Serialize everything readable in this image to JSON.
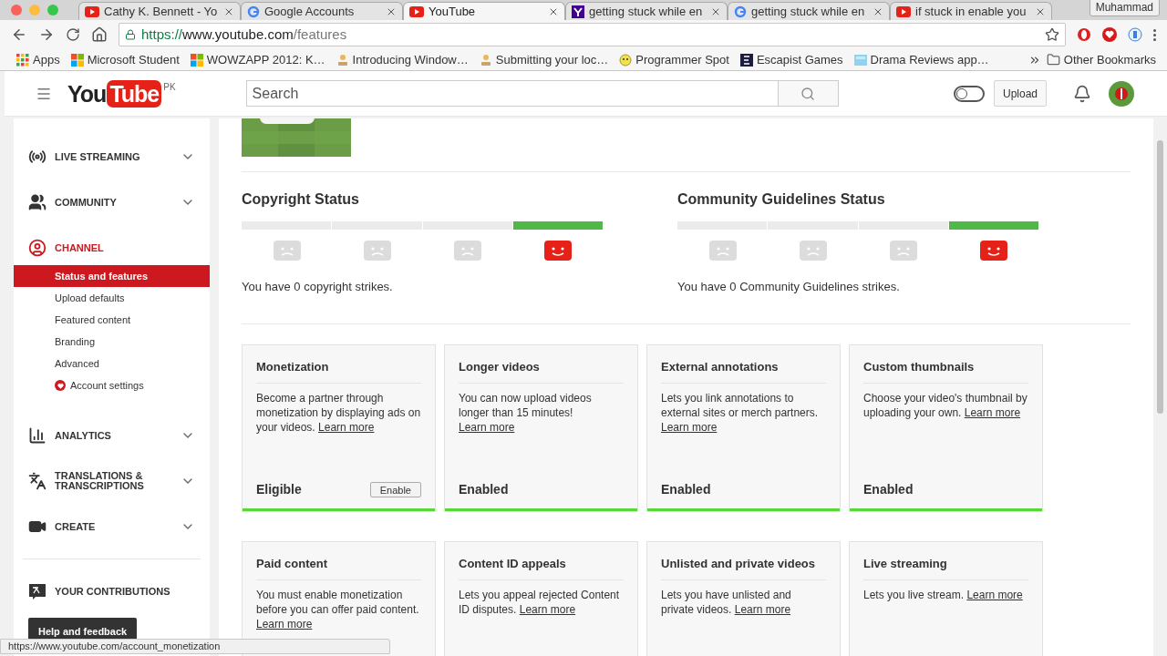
{
  "browser": {
    "tabs": [
      {
        "title": "Cathy K. Bennett - Yo",
        "kind": "youtube",
        "selected": false
      },
      {
        "title": "Google Accounts",
        "kind": "google",
        "selected": false
      },
      {
        "title": "YouTube",
        "kind": "youtube",
        "selected": true
      },
      {
        "title": "getting stuck while en",
        "kind": "yahoo",
        "selected": false
      },
      {
        "title": "getting stuck while en",
        "kind": "google",
        "selected": false
      },
      {
        "title": "if stuck in enable you",
        "kind": "youtube",
        "selected": false
      }
    ],
    "profile": "Muhammad",
    "url_scheme": "https://",
    "url_host": "www.youtube.com",
    "url_path": "/features",
    "bookmarks": [
      {
        "label": "Apps",
        "kind": "apps"
      },
      {
        "label": "Microsoft Student",
        "kind": "windows"
      },
      {
        "label": "WOWZAPP 2012: K…",
        "kind": "windows"
      },
      {
        "label": "Introducing Window…",
        "kind": "figure"
      },
      {
        "label": "Submitting your loc…",
        "kind": "figure"
      },
      {
        "label": "Programmer Spot",
        "kind": "smiley"
      },
      {
        "label": "Escapist Games",
        "kind": "dark"
      },
      {
        "label": "Drama Reviews app…",
        "kind": "tile"
      }
    ],
    "other_bookmarks": "Other Bookmarks",
    "status_url": "https://www.youtube.com/account_monetization"
  },
  "header": {
    "logo_you": "You",
    "logo_tube": "Tube",
    "region": "PK",
    "search": {
      "placeholder": "Search"
    },
    "toggle": {
      "on": false
    },
    "upload": "Upload"
  },
  "sidebar": {
    "sections": [
      {
        "label": "LIVE STREAMING",
        "kind": "live",
        "expandable": true,
        "selected": false
      },
      {
        "label": "COMMUNITY",
        "kind": "people",
        "expandable": true,
        "selected": false
      },
      {
        "label": "CHANNEL",
        "kind": "account",
        "expandable": false,
        "selected": true,
        "children": [
          {
            "label": "Status and features",
            "kind": "link",
            "selected": true
          },
          {
            "label": "Upload defaults",
            "kind": "link",
            "selected": false
          },
          {
            "label": "Featured content",
            "kind": "link",
            "selected": false
          },
          {
            "label": "Branding",
            "kind": "link",
            "selected": false
          },
          {
            "label": "Advanced",
            "kind": "link",
            "selected": false
          },
          {
            "label": "Account settings",
            "kind": "settings",
            "selected": false
          }
        ]
      },
      {
        "label": "ANALYTICS",
        "kind": "bars",
        "expandable": true,
        "selected": false
      },
      {
        "label": "TRANSLATIONS & TRANSCRIPTIONS",
        "kind": "translate",
        "expandable": true,
        "selected": false
      },
      {
        "label": "CREATE",
        "kind": "camera",
        "expandable": true,
        "selected": false
      }
    ],
    "footer_sections": [
      {
        "label": "YOUR CONTRIBUTIONS",
        "kind": "contrib"
      }
    ],
    "help": "Help and feedback"
  },
  "status_sections": [
    {
      "title": "Copyright Status",
      "segments": [
        {
          "selected": false
        },
        {
          "selected": false
        },
        {
          "selected": false
        },
        {
          "selected": true
        }
      ],
      "summary": "You have 0 copyright strikes."
    },
    {
      "title": "Community Guidelines Status",
      "segments": [
        {
          "selected": false
        },
        {
          "selected": false
        },
        {
          "selected": false
        },
        {
          "selected": true
        }
      ],
      "summary": "You have 0 Community Guidelines strikes."
    }
  ],
  "features": [
    {
      "title": "Monetization",
      "description": "Become a partner through monetization by displaying ads on your videos.",
      "link": "Learn more",
      "status": "Eligible",
      "button": "Enable"
    },
    {
      "title": "Longer videos",
      "description": "You can now upload videos longer than 15 minutes!",
      "link": "Learn more",
      "status": "Enabled"
    },
    {
      "title": "External annotations",
      "description": "Lets you link annotations to external sites or merch partners.",
      "link": "Learn more",
      "status": "Enabled"
    },
    {
      "title": "Custom thumbnails",
      "description": "Choose your video's thumbnail by uploading your own.",
      "link": "Learn more",
      "status": "Enabled"
    },
    {
      "title": "Paid content",
      "description": "You must enable monetization before you can offer paid content.",
      "link": "Learn more"
    },
    {
      "title": "Content ID appeals",
      "description": "Lets you appeal rejected Content ID disputes.",
      "link": "Learn more"
    },
    {
      "title": "Unlisted and private videos",
      "description": "Lets you have unlisted and private videos.",
      "link": "Learn more"
    },
    {
      "title": "Live streaming",
      "description": "Lets you live stream.",
      "link": "Learn more"
    }
  ]
}
